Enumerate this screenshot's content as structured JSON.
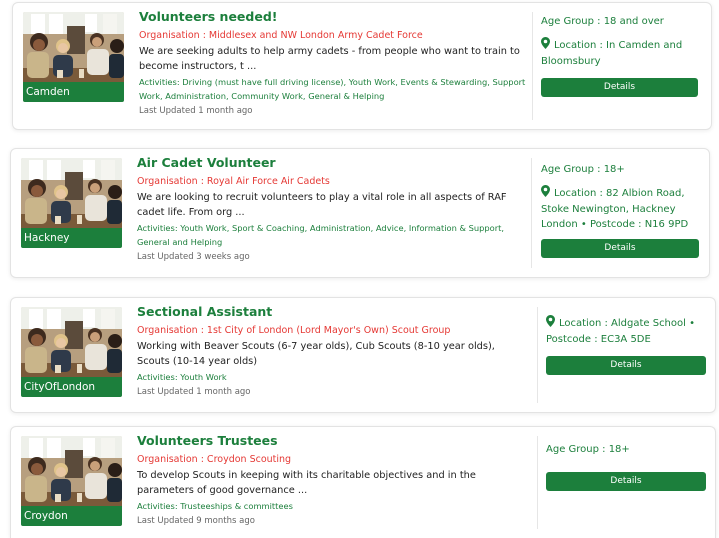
{
  "listings": [
    {
      "location_tag": "Camden",
      "title": "Volunteers needed!",
      "organisation": "Organisation : Middlesex and NW London Army Cadet Force",
      "description": "We are seeking adults to help army cadets - from people who want to train to become instructors, t ...",
      "activities": "Activities: Driving (must have full driving license), Youth Work, Events & Stewarding, Support Work, Administration, Community Work, General & Helping",
      "last_updated": "Last Updated 1 month ago",
      "age_group": "Age Group : 18 and over",
      "location": "Location : In Camden and Bloomsbury",
      "postcode": "",
      "details_label": "Details"
    },
    {
      "location_tag": "Hackney",
      "title": "Air Cadet Volunteer",
      "organisation": "Organisation : Royal Air Force Air Cadets",
      "description": "We are looking to recruit volunteers to play a vital role in all aspects of RAF cadet life. From org ...",
      "activities": "Activities: Youth Work, Sport & Coaching, Administration, Advice, Information & Support, General and Helping",
      "last_updated": "Last Updated 3 weeks ago",
      "age_group": "Age Group : 18+",
      "location": "Location : 82 Albion Road, Stoke Newington, Hackney London",
      "postcode": "Postcode : N16 9PD",
      "details_label": "Details"
    },
    {
      "location_tag": "CityOfLondon",
      "title": "Sectional Assistant",
      "organisation": "Organisation : 1st City of London (Lord Mayor's Own) Scout Group",
      "description": "Working with Beaver Scouts (6-7 year olds), Cub Scouts (8-10 year olds), Scouts (10-14 year olds)",
      "activities": "Activities: Youth Work",
      "last_updated": "Last Updated 1 month ago",
      "age_group": "",
      "location": "Location : Aldgate School",
      "postcode": "Postcode : EC3A 5DE",
      "details_label": "Details"
    },
    {
      "location_tag": "Croydon",
      "title": "Volunteers Trustees",
      "organisation": "Organisation : Croydon Scouting",
      "description": "To develop Scouts in keeping with its charitable objectives and in the parameters of good governance ...",
      "activities": "Activities: Trusteeships & committees",
      "last_updated": "Last Updated 9 months ago",
      "age_group": "Age Group : 18+",
      "location": "",
      "postcode": "",
      "details_label": "Details"
    }
  ],
  "colors": {
    "brand_green": "#1c7f3c",
    "organisation_red": "#e53935"
  },
  "icons": {
    "location": "map-pin-icon"
  }
}
